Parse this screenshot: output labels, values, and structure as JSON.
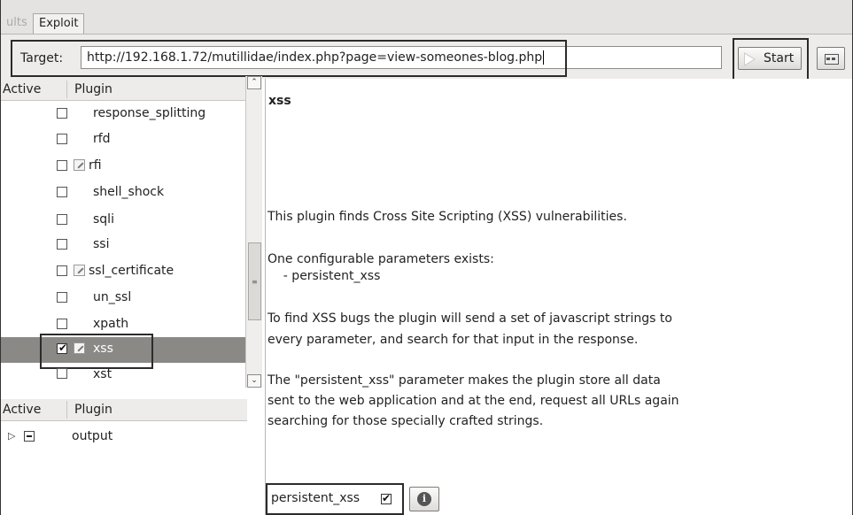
{
  "tabs": [
    {
      "label": "ults"
    },
    {
      "label": "Exploit"
    }
  ],
  "target": {
    "label": "Target:",
    "value": "http://192.168.1.72/mutillidae/index.php?page=view-someones-blog.php"
  },
  "start_button": {
    "label": "Start"
  },
  "plugin_list": {
    "header_active": "Active",
    "header_plugin": "Plugin",
    "items": [
      {
        "name": "response_splitting",
        "checked": false,
        "configurable": false
      },
      {
        "name": "rfd",
        "checked": false,
        "configurable": false
      },
      {
        "name": "rfi",
        "checked": false,
        "configurable": true
      },
      {
        "name": "shell_shock",
        "checked": false,
        "configurable": false
      },
      {
        "name": "sqli",
        "checked": false,
        "configurable": false
      },
      {
        "name": "ssi",
        "checked": false,
        "configurable": false
      },
      {
        "name": "ssl_certificate",
        "checked": false,
        "configurable": true
      },
      {
        "name": "un_ssl",
        "checked": false,
        "configurable": false
      },
      {
        "name": "xpath",
        "checked": false,
        "configurable": false
      },
      {
        "name": "xss",
        "checked": true,
        "configurable": true,
        "selected": true
      },
      {
        "name": "xst",
        "checked": false,
        "configurable": false
      }
    ]
  },
  "output_list": {
    "header_active": "Active",
    "header_plugin": "Plugin",
    "items": [
      {
        "name": "output"
      }
    ]
  },
  "detail": {
    "title": "xss",
    "lines": [
      "This plugin finds Cross Site Scripting (XSS) vulnerabilities.",
      "One configurable parameters exists:",
      "    - persistent_xss",
      "To find XSS bugs the plugin will send a set of javascript strings to",
      "every parameter, and search for that input in the response.",
      "The \"persistent_xss\" parameter makes the plugin store all data",
      "sent to the web application and at the end, request all URLs again",
      "searching for those specially crafted strings."
    ],
    "option": {
      "label": "persistent_xss",
      "checked": true
    }
  },
  "colors": {
    "selected_row": "#8a8986",
    "highlight_border": "#2b2b2b"
  }
}
